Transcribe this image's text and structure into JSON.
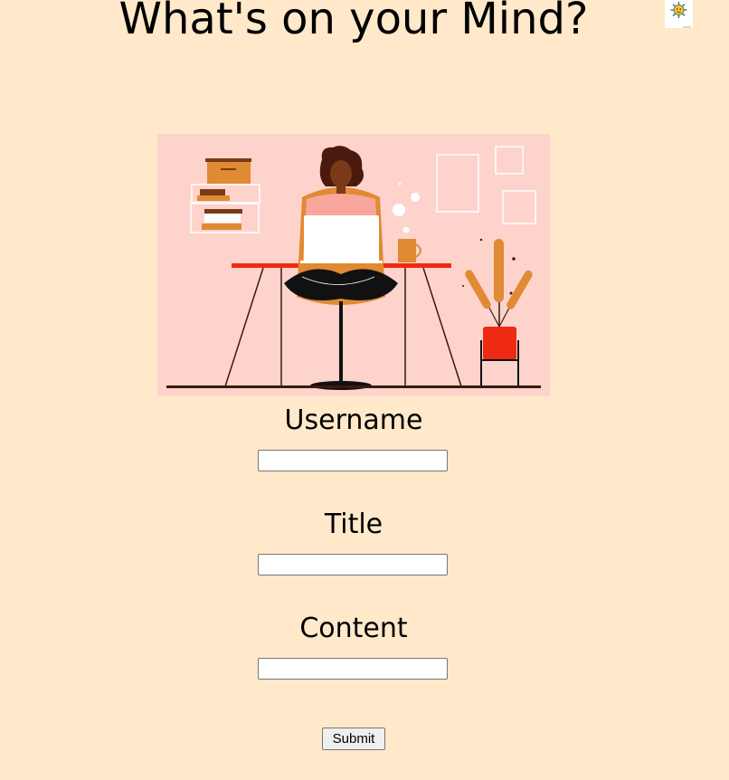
{
  "header": {
    "title": "What's on your Mind?"
  },
  "logo": {
    "icon": "sun-logo-icon"
  },
  "hero": {
    "icon": "woman-at-desk-illustration",
    "background": "#fdd3cc"
  },
  "form": {
    "username": {
      "label": "Username",
      "value": "",
      "placeholder": ""
    },
    "title": {
      "label": "Title",
      "value": "",
      "placeholder": ""
    },
    "content": {
      "label": "Content",
      "value": "",
      "placeholder": ""
    },
    "submit_label": "Submit"
  },
  "colors": {
    "page_background": "#ffe9ca",
    "accent_orange": "#e5842a",
    "accent_red": "#ee2a12"
  }
}
